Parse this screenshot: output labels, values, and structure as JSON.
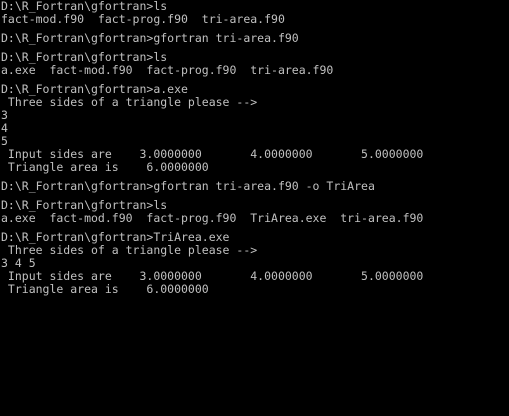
{
  "console": {
    "lines": [
      "D:\\R_Fortran\\gfortran>ls",
      "fact-mod.f90  fact-prog.f90  tri-area.f90",
      "",
      "D:\\R_Fortran\\gfortran>gfortran tri-area.f90",
      "",
      "D:\\R_Fortran\\gfortran>ls",
      "a.exe  fact-mod.f90  fact-prog.f90  tri-area.f90",
      "",
      "D:\\R_Fortran\\gfortran>a.exe",
      " Three sides of a triangle please -->",
      "3",
      "4",
      "5",
      " Input sides are    3.0000000       4.0000000       5.0000000",
      " Triangle area is    6.0000000",
      "",
      "D:\\R_Fortran\\gfortran>gfortran tri-area.f90 -o TriArea",
      "",
      "D:\\R_Fortran\\gfortran>ls",
      "a.exe  fact-mod.f90  fact-prog.f90  TriArea.exe  tri-area.f90",
      "",
      "D:\\R_Fortran\\gfortran>TriArea.exe",
      " Three sides of a triangle please -->",
      "3 4 5",
      " Input sides are    3.0000000       4.0000000       5.0000000",
      " Triangle area is    6.0000000"
    ]
  }
}
